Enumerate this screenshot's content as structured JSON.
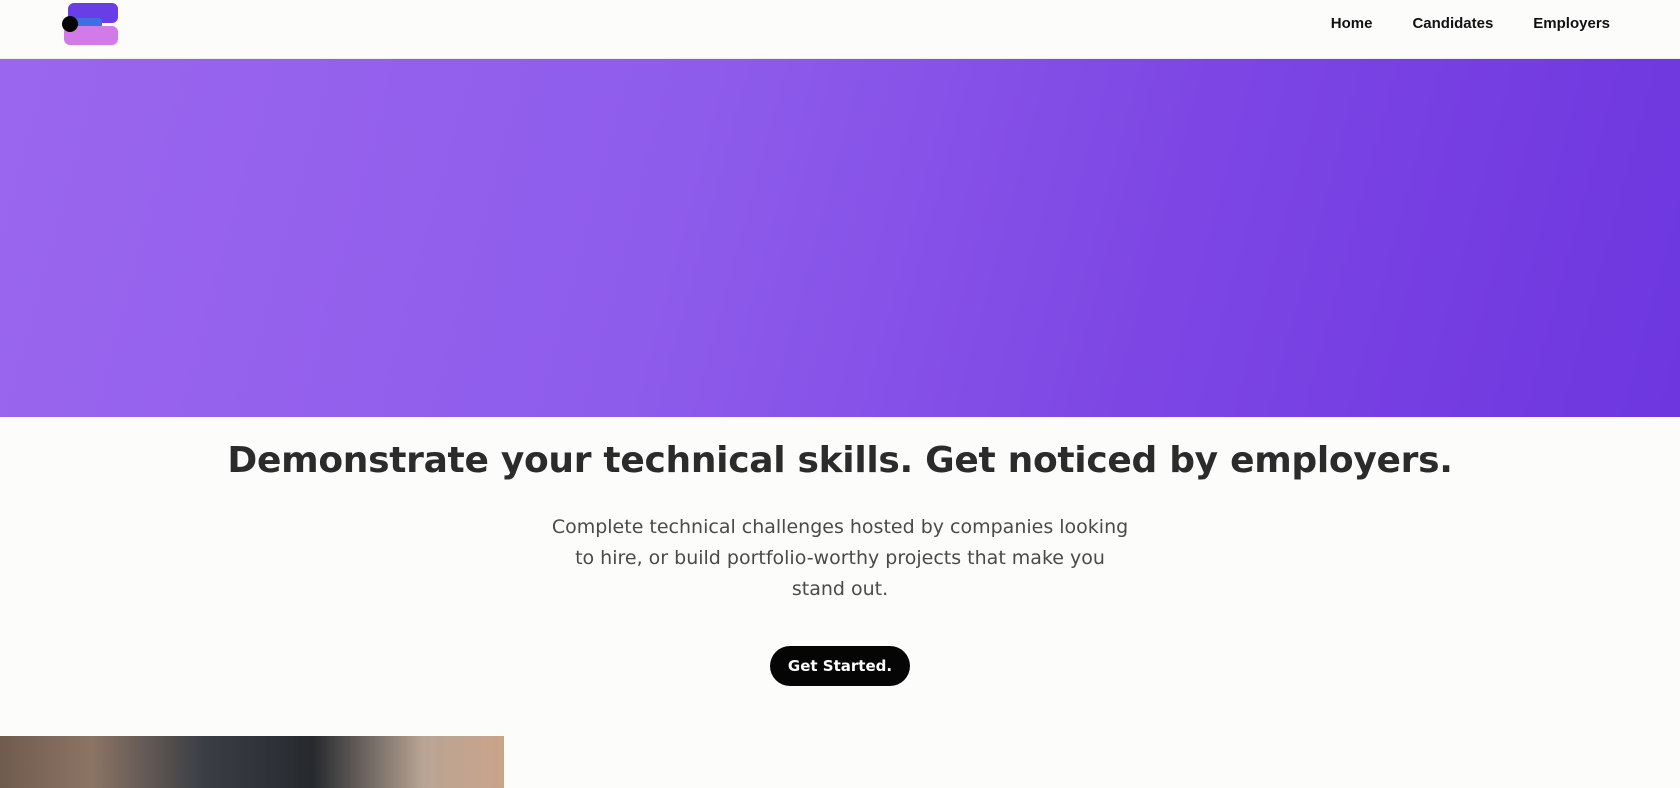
{
  "header": {
    "logo_name": "brand-logo",
    "nav": [
      {
        "label": "Home"
      },
      {
        "label": "Candidates"
      },
      {
        "label": "Employers"
      }
    ]
  },
  "hero": {
    "gradient_colors": [
      "#9a66ef",
      "#6d36df"
    ]
  },
  "main": {
    "headline": "Demonstrate your technical skills. Get noticed by employers.",
    "subtitle": "Complete technical challenges hosted by companies looking to hire, or build portfolio-worthy projects that make you stand out.",
    "cta_label": "Get Started."
  },
  "colors": {
    "accent_purple": "#8a57ea",
    "logo_violet": "#6a3ee6",
    "logo_pink": "#d27be8",
    "button_black": "#050505"
  }
}
